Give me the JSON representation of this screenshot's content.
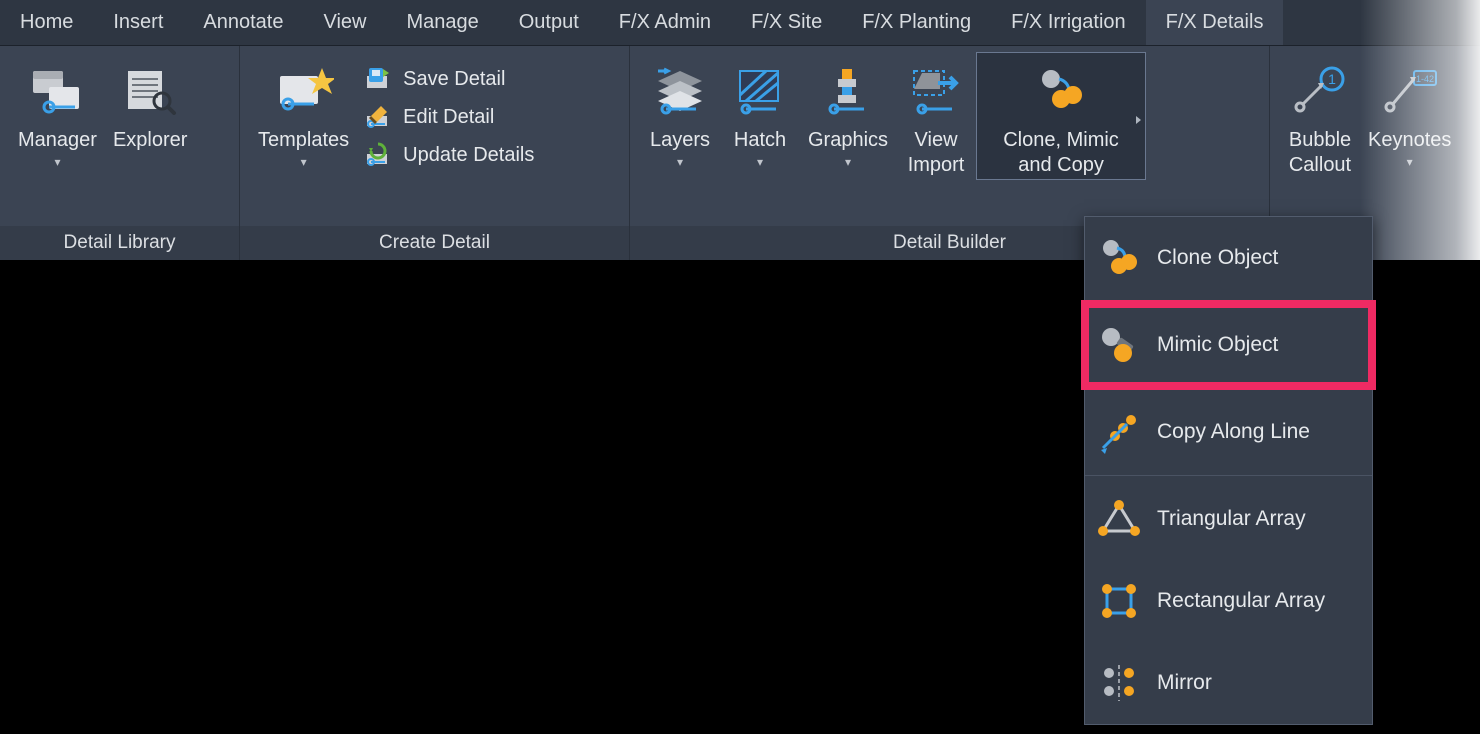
{
  "tabs": {
    "home": "Home",
    "insert": "Insert",
    "annotate": "Annotate",
    "view": "View",
    "manage": "Manage",
    "output": "Output",
    "fxadmin": "F/X Admin",
    "fxsite": "F/X Site",
    "fxplanting": "F/X Planting",
    "fxirrigation": "F/X Irrigation",
    "fxdetails": "F/X Details"
  },
  "panels": {
    "library": {
      "title": "Detail Library",
      "manager": "Manager",
      "explorer": "Explorer"
    },
    "create": {
      "title": "Create Detail",
      "templates": "Templates",
      "save": "Save Detail",
      "edit": "Edit Detail",
      "update": "Update Details"
    },
    "builder": {
      "title": "Detail Builder",
      "layers": "Layers",
      "hatch": "Hatch",
      "graphics": "Graphics",
      "viewimport": "View\nImport",
      "clonemimic": "Clone, Mimic\nand Copy"
    },
    "tail": {
      "bubble": "Bubble\nCallout",
      "keynotes": "Keynotes"
    }
  },
  "menu": {
    "clone": "Clone Object",
    "mimic": "Mimic Object",
    "copyalong": "Copy Along Line",
    "triarray": "Triangular Array",
    "rectarray": "Rectangular Array",
    "mirror": "Mirror"
  },
  "colors": {
    "accent": "#f5a623",
    "accent2": "#3aa0e8",
    "bg": "#3b4453"
  }
}
